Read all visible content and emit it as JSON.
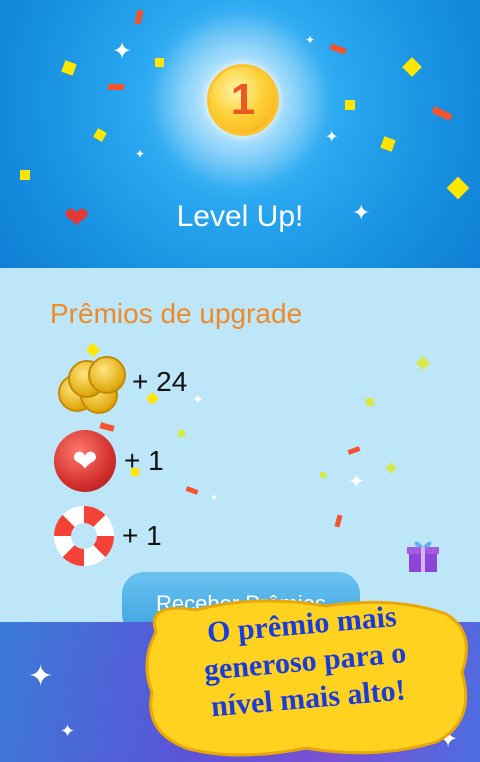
{
  "header": {
    "level_number": "1",
    "title": "Level Up!"
  },
  "rewards": {
    "title": "Prêmios de upgrade",
    "items": [
      {
        "icon": "coins-icon",
        "amount": "+ 24"
      },
      {
        "icon": "heart-icon",
        "amount": "+ 1"
      },
      {
        "icon": "lifebuoy-icon",
        "amount": "+ 1"
      }
    ]
  },
  "receive_button": {
    "label": "Receber Prêmios"
  },
  "promo": {
    "line1": "O prêmio mais",
    "line2": "generoso para o",
    "line3": "nível mais alto!"
  },
  "colors": {
    "header_blue": "#1790e0",
    "panel_bg": "#bde6f8",
    "title_orange": "#f08a28",
    "promo_text": "#1a3cd8",
    "promo_bubble": "#ffd21f"
  }
}
